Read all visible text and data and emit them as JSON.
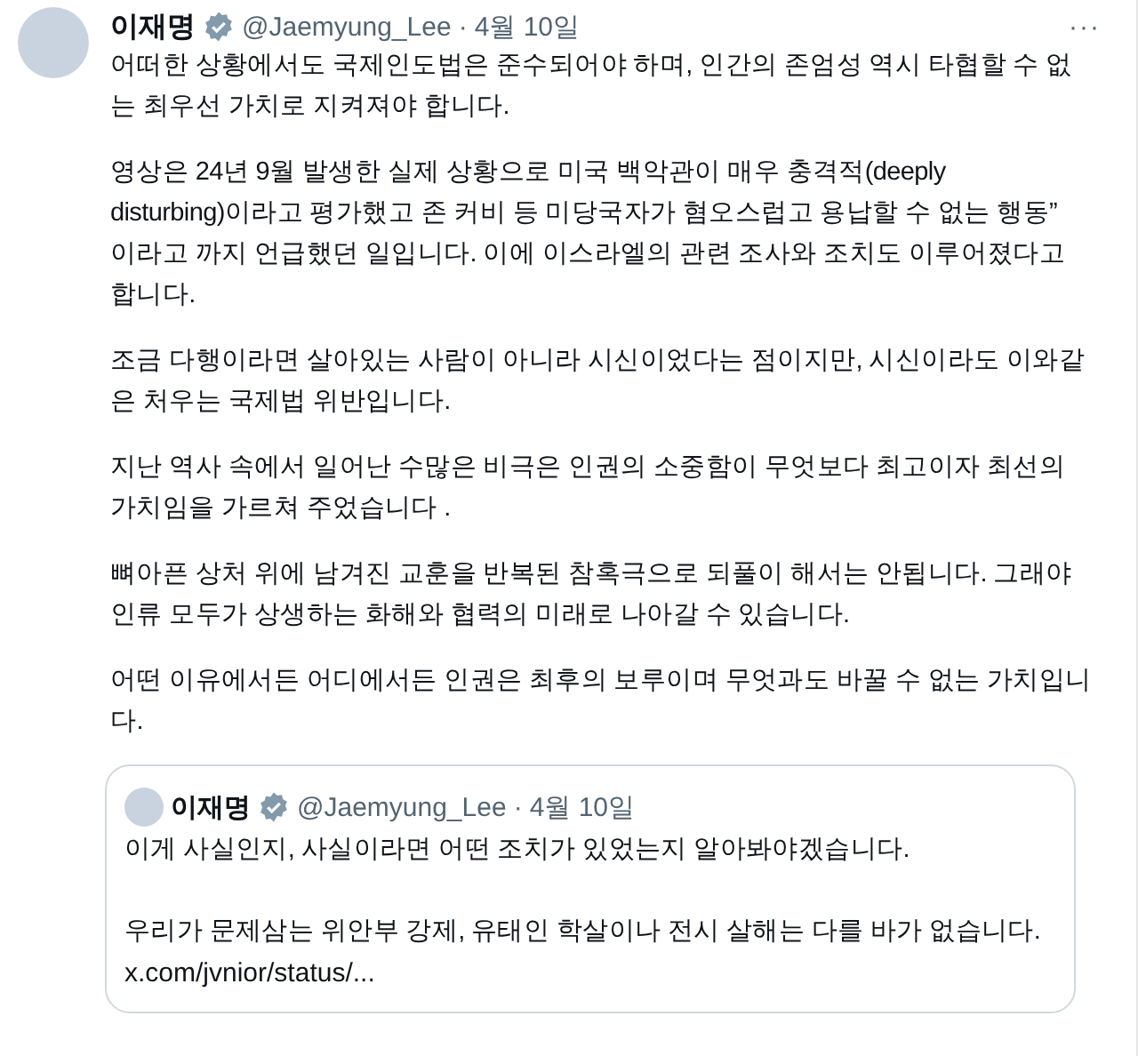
{
  "tweet": {
    "name": "이재명",
    "handle": "@Jaemyung_Lee",
    "separator": "·",
    "date": "4월 10일",
    "verified": true,
    "more": "···",
    "paragraphs": [
      "어떠한 상황에서도 국제인도법은 준수되어야 하며, 인간의 존엄성 역시 타협할 수 없\n는 최우선 가치로 지켜져야 합니다.",
      "영상은 24년 9월 발생한 실제 상황으로 미국 백악관이 매우 충격적(deeply\ndisturbing)이라고 평가했고 존 커비 등 미당국자가 혐오스럽고 용납할 수 없는 행동”\n이라고 까지 언급했던 일입니다. 이에 이스라엘의 관련 조사와 조치도 이루어졌다고\n합니다.",
      "조금 다행이라면 살아있는 사람이 아니라 시신이었다는 점이지만, 시신이라도 이와같\n은 처우는 국제법 위반입니다.",
      "지난 역사 속에서 일어난 수많은 비극은 인권의 소중함이 무엇보다 최고이자 최선의\n가치임을 가르쳐 주었습니다 .",
      "뼈아픈 상처 위에 남겨진 교훈을 반복된 참혹극으로 되풀이 해서는 안됩니다. 그래야\n인류 모두가 상생하는 화해와 협력의 미래로 나아갈 수 있습니다.",
      "어떤 이유에서든 어디에서든 인권은 최후의 보루이며 무엇과도 바꿀 수 없는 가치입니\n다."
    ]
  },
  "quoted": {
    "name": "이재명",
    "handle": "@Jaemyung_Lee",
    "separator": "·",
    "date": "4월 10일",
    "verified": true,
    "paragraphs": [
      "이게 사실인지, 사실이라면 어떤 조치가 있었는지 알아봐야겠습니다.",
      "우리가 문제삼는 위안부 강제, 유태인 학살이나 전시 살해는 다를 바가 없습니다."
    ],
    "link": "x.com/jvnior/status/..."
  }
}
